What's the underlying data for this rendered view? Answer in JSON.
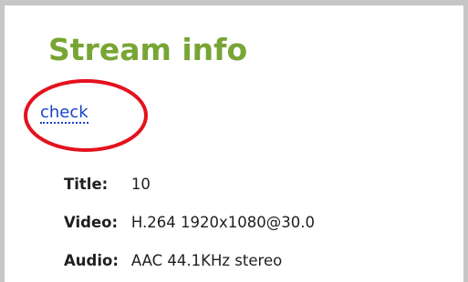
{
  "panel": {
    "title": "Stream info",
    "check_link": "check",
    "rows": [
      {
        "label": "Title:",
        "value": "10"
      },
      {
        "label": "Video:",
        "value": "H.264 1920x1080@30.0"
      },
      {
        "label": "Audio:",
        "value": "AAC 44.1KHz stereo"
      }
    ]
  },
  "colors": {
    "title": "#78a534",
    "link": "#1a43cc",
    "callout": "#e4121e",
    "border": "#c6c6c6"
  }
}
